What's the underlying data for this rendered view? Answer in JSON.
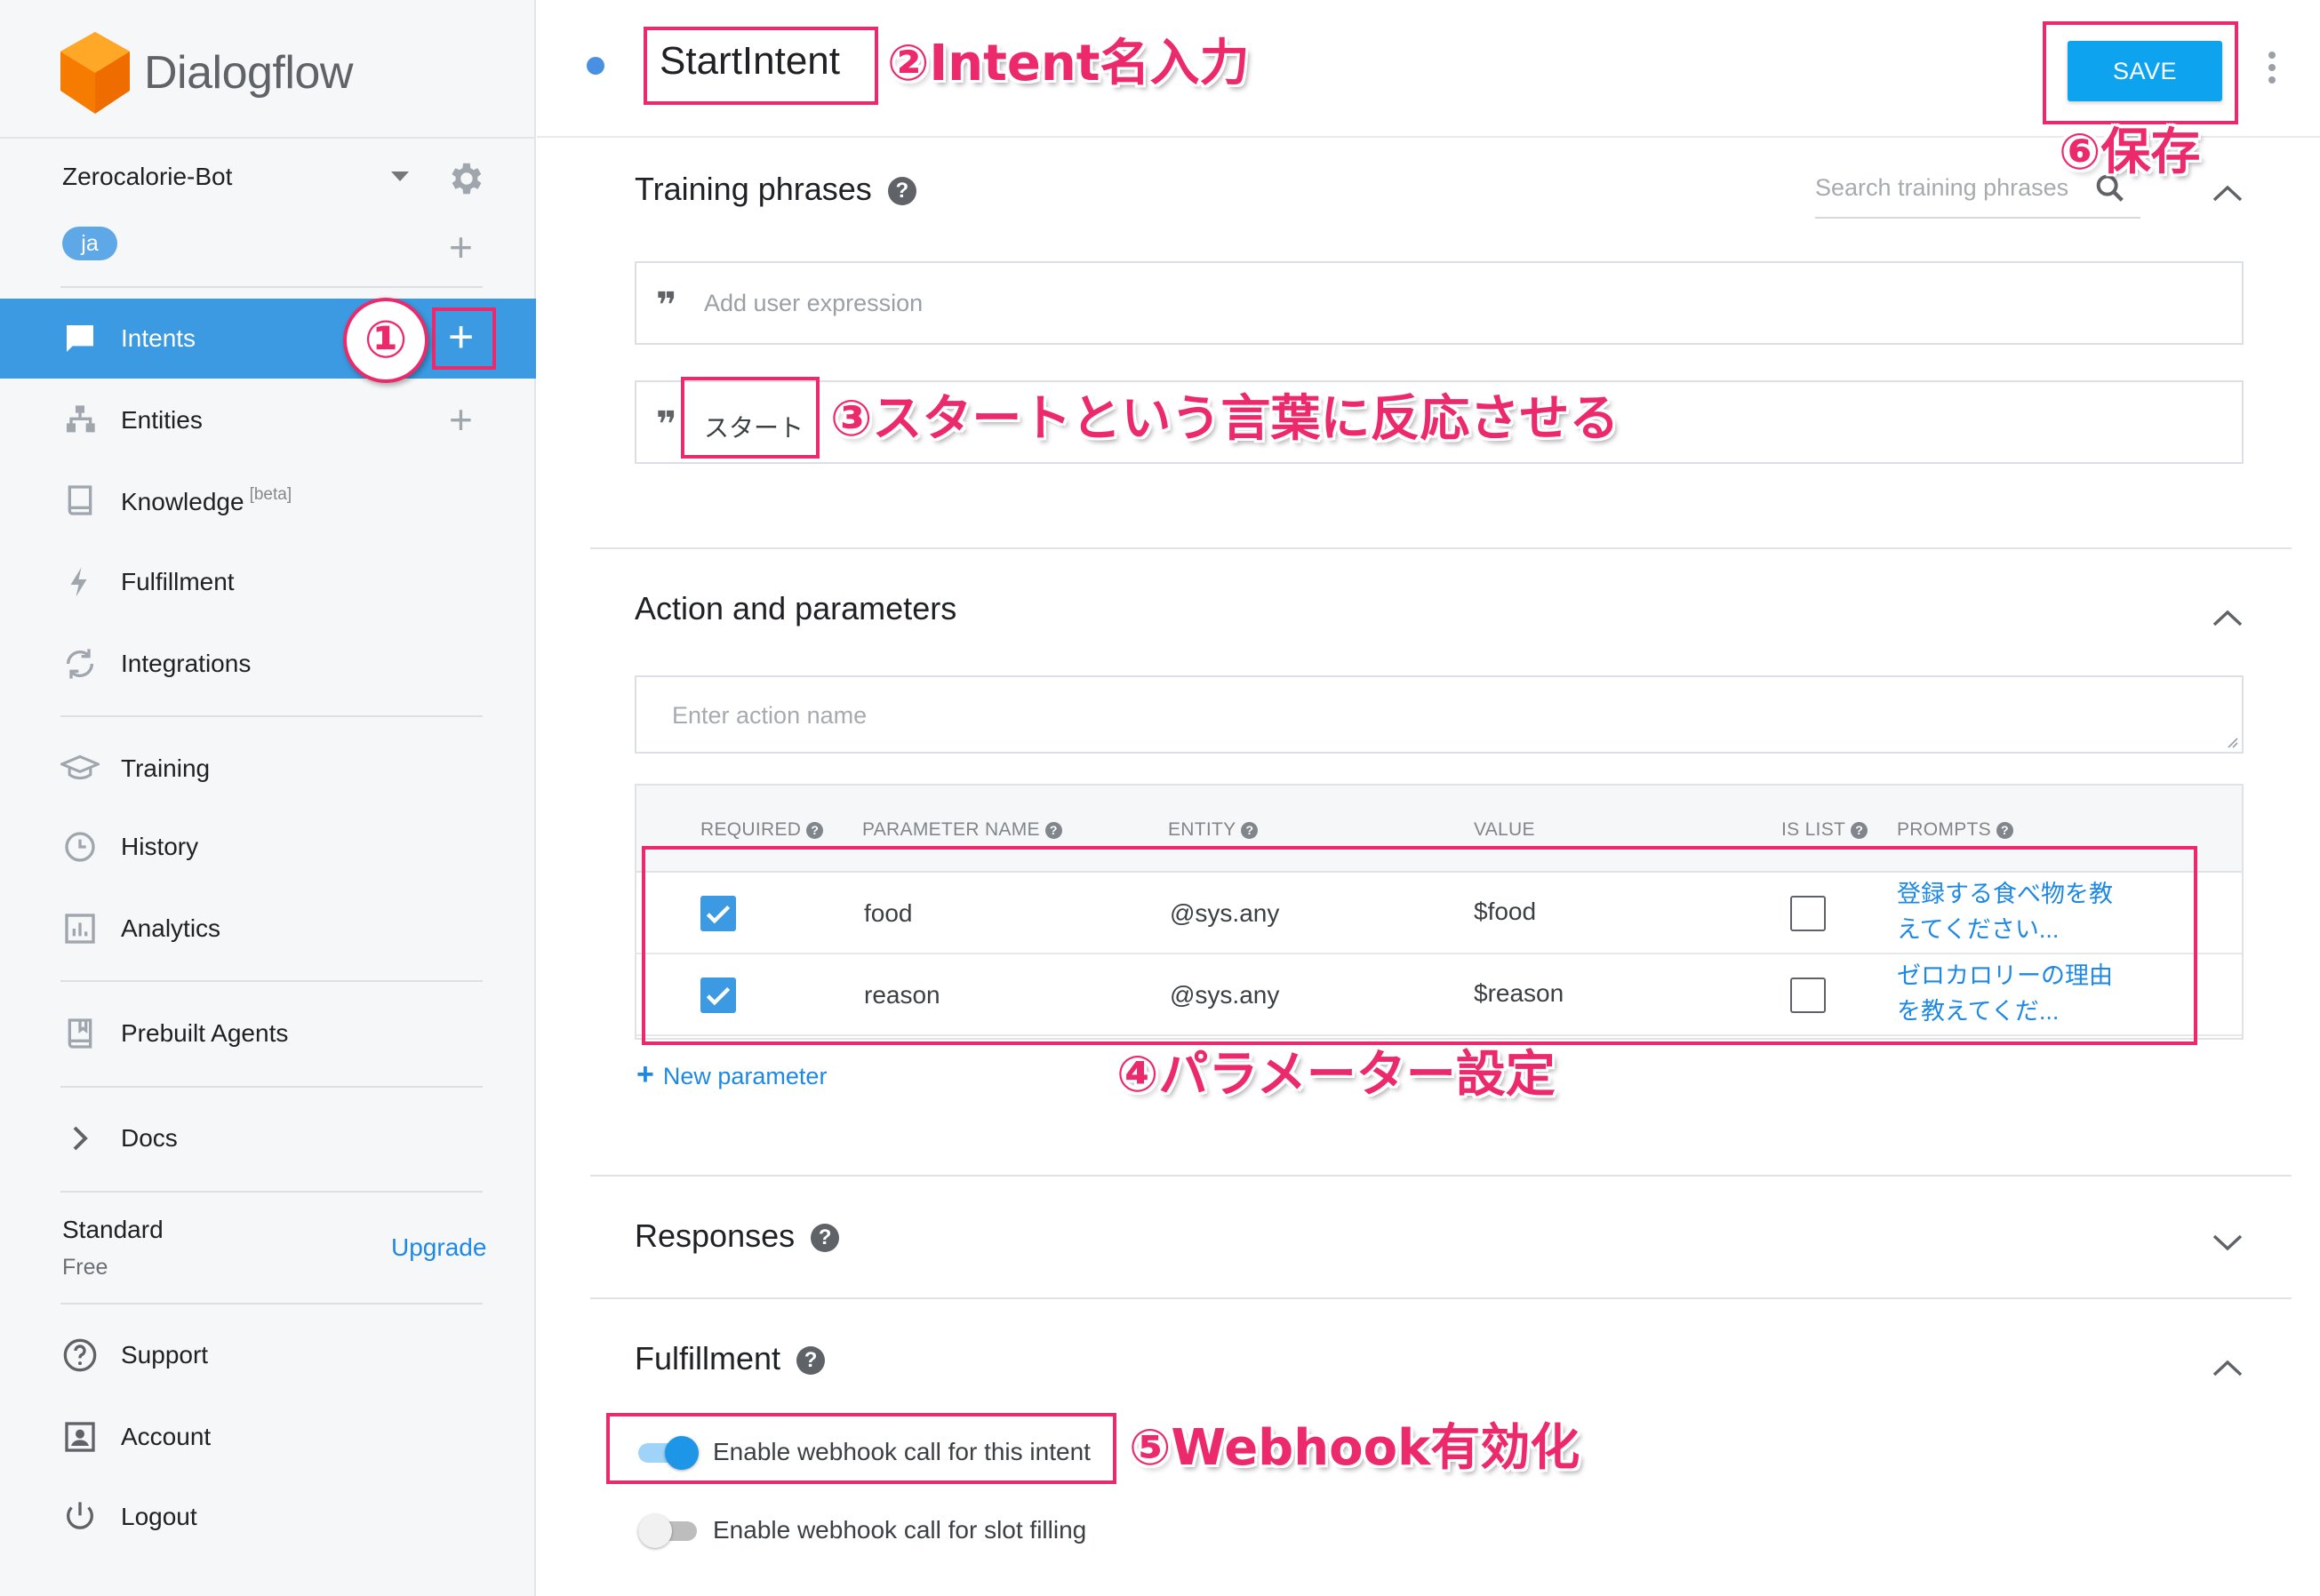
{
  "app": {
    "brand_name": "Dialogflow",
    "accent_color": "#3b9ae1",
    "brand_color": "#f57c00"
  },
  "sidebar": {
    "agent_name": "Zerocalorie-Bot",
    "language": "ja",
    "items": [
      {
        "label": "Intents",
        "icon": "chat-icon",
        "active": true
      },
      {
        "label": "Entities",
        "icon": "hierarchy-icon"
      },
      {
        "label": "Knowledge",
        "badge": "[beta]",
        "icon": "book-icon"
      },
      {
        "label": "Fulfillment",
        "icon": "bolt-icon"
      },
      {
        "label": "Integrations",
        "icon": "sync-icon"
      },
      {
        "label": "Training",
        "icon": "graduation-cap-icon"
      },
      {
        "label": "History",
        "icon": "clock-icon"
      },
      {
        "label": "Analytics",
        "icon": "bar-chart-icon"
      },
      {
        "label": "Prebuilt Agents",
        "icon": "book-icon"
      },
      {
        "label": "Docs",
        "icon": "chevron-right-icon"
      },
      {
        "label": "Support",
        "icon": "help-circle-icon"
      },
      {
        "label": "Account",
        "icon": "account-icon"
      },
      {
        "label": "Logout",
        "icon": "power-icon"
      }
    ],
    "plan": {
      "name": "Standard",
      "tier": "Free",
      "upgrade_label": "Upgrade"
    }
  },
  "header": {
    "intent_name": "StartIntent",
    "save_label": "SAVE"
  },
  "training_phrases": {
    "title": "Training phrases",
    "search_placeholder": "Search training phrases",
    "add_placeholder": "Add user expression",
    "phrases": [
      "スタート"
    ]
  },
  "action": {
    "title": "Action and parameters",
    "action_placeholder": "Enter action name",
    "columns": [
      "REQUIRED",
      "PARAMETER NAME",
      "ENTITY",
      "VALUE",
      "IS LIST",
      "PROMPTS"
    ],
    "params": [
      {
        "required": true,
        "name": "food",
        "entity": "@sys.any",
        "value": "$food",
        "is_list": false,
        "prompt_line1": "登録する食べ物を教",
        "prompt_line2": "えてください..."
      },
      {
        "required": true,
        "name": "reason",
        "entity": "@sys.any",
        "value": "$reason",
        "is_list": false,
        "prompt_line1": "ゼロカロリーの理由",
        "prompt_line2": "を教えてくだ..."
      }
    ],
    "new_param_label": "New parameter"
  },
  "responses": {
    "title": "Responses"
  },
  "fulfillment": {
    "title": "Fulfillment",
    "webhook_label": "Enable webhook call for this intent",
    "webhook_enabled": true,
    "slot_label": "Enable webhook call for slot filling",
    "slot_enabled": false
  },
  "annotations": {
    "a1": "①",
    "a2": "②Intent名入力",
    "a3": "③スタートという言葉に反応させる",
    "a4": "④パラメーター設定",
    "a5": "⑤Webhook有効化",
    "a6": "⑥保存",
    "color": "#ec2a6b"
  }
}
